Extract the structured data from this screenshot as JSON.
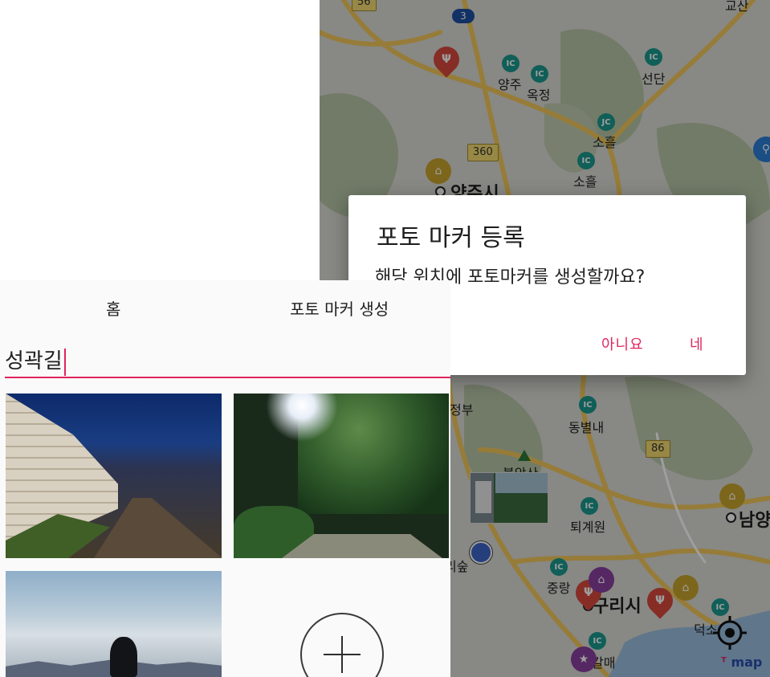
{
  "map": {
    "places": [
      "양주",
      "옥정",
      "선단",
      "소흘",
      "소흘",
      "양주시",
      "정부",
      "동별내",
      "불암산",
      "퇴계원",
      "중랑",
      "구리시",
      "남양",
      "덕소",
      "갈매",
      "리숲",
      "교산",
      "남"
    ],
    "ic_label": "IC",
    "jc_label": "JC",
    "route_shields": [
      "360",
      "86",
      "56"
    ],
    "route_badge": "3",
    "brand": "map"
  },
  "dialog": {
    "title": "포토 마커 등록",
    "message": "해당 위치에 포토마커를 생성할까요?",
    "no_label": "아니요",
    "yes_label": "네",
    "accent": "#e0245e"
  },
  "panel": {
    "tabs": [
      "홈",
      "포토 마커 생성"
    ],
    "search_value": "성곽길"
  }
}
